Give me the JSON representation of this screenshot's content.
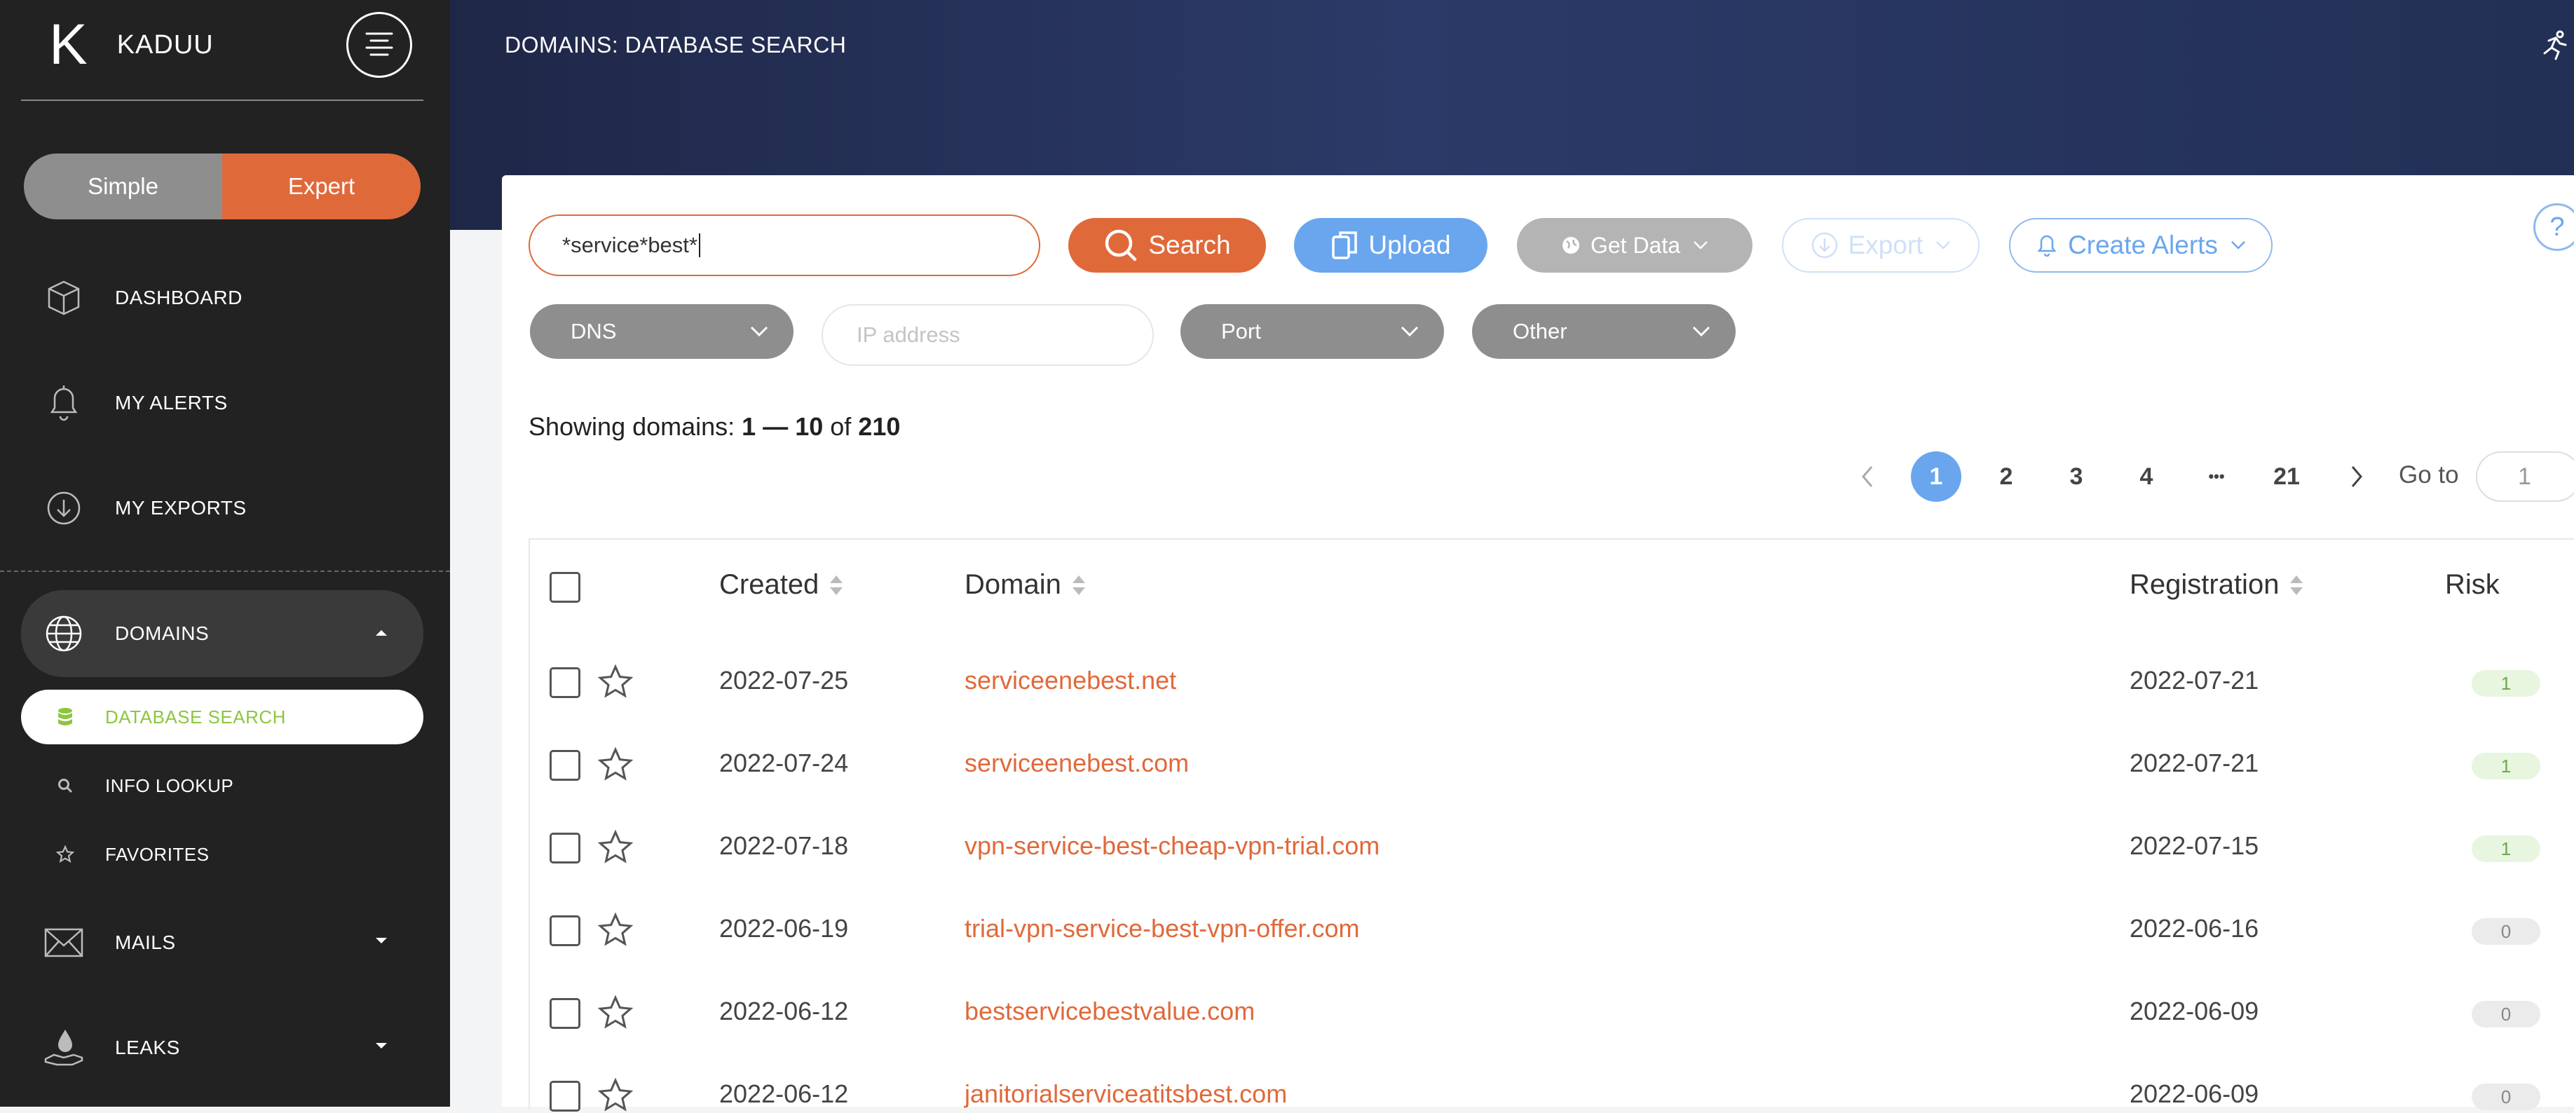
{
  "brand": {
    "logo": "K",
    "name": "KADUU"
  },
  "mode": {
    "simple": "Simple",
    "expert": "Expert"
  },
  "nav": {
    "dashboard": "DASHBOARD",
    "alerts": "MY ALERTS",
    "exports": "MY EXPORTS",
    "domains": "DOMAINS",
    "mails": "MAILS",
    "leaks": "LEAKS"
  },
  "subnav": {
    "database_search": "DATABASE SEARCH",
    "info_lookup": "INFO LOOKUP",
    "favorites": "FAVORITES"
  },
  "header": {
    "title": "DOMAINS: DATABASE SEARCH"
  },
  "toolbar": {
    "search_value": "*service*best*",
    "search_label": "Search",
    "upload_label": "Upload",
    "getdata_label": "Get Data",
    "export_label": "Export",
    "alerts_label": "Create Alerts",
    "help": "?"
  },
  "filters": {
    "dns": "DNS",
    "ip_placeholder": "IP address",
    "port": "Port",
    "other": "Other"
  },
  "summary": {
    "prefix": "Showing domains: ",
    "from": "1",
    "dash": " — ",
    "to": "10",
    "of": " of ",
    "total": "210"
  },
  "pagination": {
    "pages": [
      "1",
      "2",
      "3",
      "4",
      "•••",
      "21"
    ],
    "current": "1",
    "goto_label": "Go to",
    "goto_value": "1"
  },
  "table": {
    "headers": {
      "created": "Created",
      "domain": "Domain",
      "registration": "Registration",
      "risk": "Risk"
    },
    "rows": [
      {
        "created": "2022-07-25",
        "domain": "serviceenebest.net",
        "registration": "2022-07-21",
        "risk": "1"
      },
      {
        "created": "2022-07-24",
        "domain": "serviceenebest.com",
        "registration": "2022-07-21",
        "risk": "1"
      },
      {
        "created": "2022-07-18",
        "domain": "vpn-service-best-cheap-vpn-trial.com",
        "registration": "2022-07-15",
        "risk": "1"
      },
      {
        "created": "2022-06-19",
        "domain": "trial-vpn-service-best-vpn-offer.com",
        "registration": "2022-06-16",
        "risk": "0"
      },
      {
        "created": "2022-06-12",
        "domain": "bestservicebestvalue.com",
        "registration": "2022-06-09",
        "risk": "0"
      },
      {
        "created": "2022-06-12",
        "domain": "janitorialserviceatitsbest.com",
        "registration": "2022-06-09",
        "risk": "0"
      }
    ]
  },
  "colors": {
    "accent": "#e0693a",
    "blue": "#6aa6ee",
    "sidebar": "#222222",
    "header": "#2b3a68"
  }
}
